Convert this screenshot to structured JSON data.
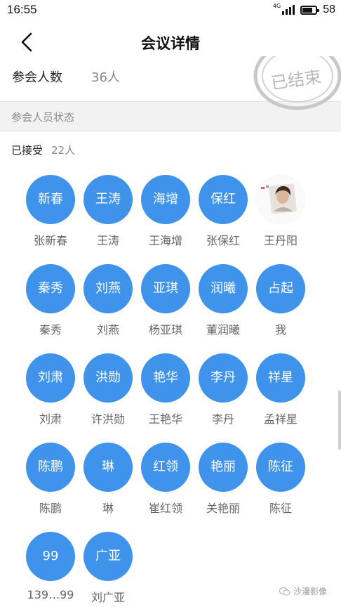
{
  "status_bar": {
    "time": "16:55",
    "network": "4G",
    "battery": "58"
  },
  "header": {
    "title": "会议详情"
  },
  "meeting": {
    "count_label": "参会人数",
    "count_value": "36人",
    "stamp_text": "已结束"
  },
  "section": {
    "title": "参会人员状态"
  },
  "accepted": {
    "label": "已接受",
    "count": "22人"
  },
  "people": [
    {
      "avatar": "新春",
      "name": "张新春"
    },
    {
      "avatar": "王涛",
      "name": "王涛"
    },
    {
      "avatar": "海增",
      "name": "王海增"
    },
    {
      "avatar": "保红",
      "name": "张保红"
    },
    {
      "avatar": "",
      "name": "王丹阳",
      "photo": true
    },
    {
      "avatar": "秦秀",
      "name": "秦秀"
    },
    {
      "avatar": "刘燕",
      "name": "刘燕"
    },
    {
      "avatar": "亚琪",
      "name": "杨亚琪"
    },
    {
      "avatar": "润曦",
      "name": "董润曦"
    },
    {
      "avatar": "占起",
      "name": "我"
    },
    {
      "avatar": "刘肃",
      "name": "刘肃"
    },
    {
      "avatar": "洪勋",
      "name": "许洪勋"
    },
    {
      "avatar": "艳华",
      "name": "王艳华"
    },
    {
      "avatar": "李丹",
      "name": "李丹"
    },
    {
      "avatar": "祥星",
      "name": "孟祥星"
    },
    {
      "avatar": "陈鹏",
      "name": "陈鹏"
    },
    {
      "avatar": "琳",
      "name": "琳"
    },
    {
      "avatar": "红领",
      "name": "崔红领"
    },
    {
      "avatar": "艳丽",
      "name": "关艳丽"
    },
    {
      "avatar": "陈征",
      "name": "陈征"
    },
    {
      "avatar": "99",
      "name": "139…99"
    },
    {
      "avatar": "广亚",
      "name": "刘广亚"
    }
  ],
  "watermark": {
    "text": "沙漫影像"
  },
  "colors": {
    "avatar_bg": "#3f93ea",
    "section_bg": "#f2f2f2"
  }
}
